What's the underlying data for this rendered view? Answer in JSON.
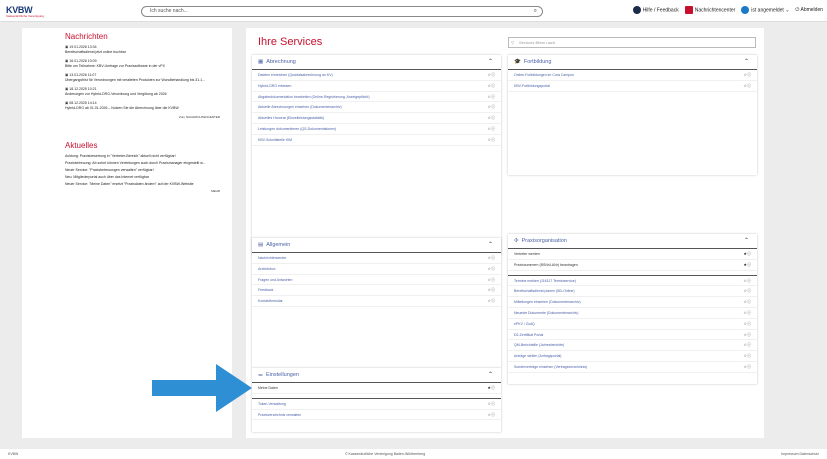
{
  "header": {
    "logo_main": "KVBW",
    "logo_sub": "Kassenärztliche Vereinigung",
    "search_placeholder": "Ich suche nach...",
    "help": "Hilfe / Feedback",
    "messages": "Nachrichtencenter",
    "user": "ist angemeldet",
    "logout": "Abmelden"
  },
  "left": {
    "news_title": "Nachrichten",
    "news": [
      {
        "date": "19.01.2026 13:34",
        "text": "Bereitschaftsdienst jetzt online buchbar"
      },
      {
        "date": "16.01.2026 10:09",
        "text": "Bitte um Teilnahme: KBV-Umfrage zur Praxissoftware in der vPX"
      },
      {
        "date": "13.01.2026 11:07",
        "text": "Übergangsfrist für Verordnungen mit veralteten Produkten zur Wundbehandlung bis 31.1..."
      },
      {
        "date": "18.12.2025 10:21",
        "text": "Änderungen zur Hybrid-DRG-Verordnung und Vergütung ab 2026"
      },
      {
        "date": "08.12.2025 14:14",
        "text": "Hybrid-DRG ab 01.01.2026 – Nutzen Sie die Abrechnung über die KVBW"
      }
    ],
    "news_more": "Zum NACHRICHTENCENTER",
    "aktuell_title": "Aktuelles",
    "aktuell": [
      "Achtung: Praxisbewertung in \"Vertreter-Bereich\" aktuell nicht verfügbar!",
      "Praxisbetreuung: Ab sofort können Vertretungen auch durch Praxismanager eingestellt w...",
      "Neuer Service: \"Praxisbetreuungen verwalten\" verfügbar!",
      "Neu: Mitgliederportal auch über das Internet verfügbar",
      "Neuer Service: \"Meine Daten\" ersetzt \"Praxisdaten ändern\" auf der KVBW-Website"
    ],
    "aktuell_more": "MEHR"
  },
  "main": {
    "title": "Ihre Services",
    "filter_placeholder": "Services filtern nach"
  },
  "cards": {
    "abrechnung": {
      "title": "Abrechnung",
      "items": [
        "Dateien einreichen (Quartalsabrechnung an KV)",
        "Hybrid-DRG erfassen",
        "Abgabedokumentation bearbeiten (Online-Registrierung, Anzeigepflicht)",
        "Aktuelle Abrechnungen einsehen (Dokumentenarchiv)",
        "Aktuelles Honorar (Einzelleistungsstatistik)",
        "Leistungen dokumentieren (QS-Dokumentationen)",
        "KBV-Schnittstelle KIM"
      ]
    },
    "fortbildung": {
      "title": "Fortbildung",
      "items": [
        "Online-Fortbildungen im Cura Campus",
        "KBV-Fortbildungsportal"
      ]
    },
    "allgemein": {
      "title": "Allgemein",
      "items": [
        "Nachrichtencenter",
        "Arztinfobox",
        "Fragen und Antworten",
        "Feedback",
        "Kontaktformular"
      ]
    },
    "praxis": {
      "title": "Praxisorganisation",
      "items_top": [
        "Vertreter werden",
        "Praxisnummern (BSNr/LANr) beantragen"
      ],
      "items_bottom": [
        "Termine melden (116117 Terminservice)",
        "Bereitschaftsdienst planen (BD-Online)",
        "Mitteilungen einsehen (Dokumentenarchiv)",
        "Neueste Dokumente (Dokumentenarchiv)",
        "ePKV / ZodQ",
        "D2-Zertifikat Portal",
        "QM-Berichtsfile (Jahresberichte)",
        "Anträge stellen (Antragsportal)",
        "Sonderverträge einsehen (Vertragsverzeichnis)"
      ]
    },
    "einstellungen": {
      "title": "Einstellungen",
      "items_top": [
        "Meine Daten"
      ],
      "items_bottom": [
        "Token-Verwaltung",
        "Praxisverzeichnis verwalten"
      ]
    }
  },
  "icons": {
    "star": "☆",
    "star_filled": "★",
    "info": "ⓘ",
    "chevron_up": "⌃"
  },
  "footer": {
    "left": "KVBW",
    "center": "© Kassenärztliche Vereinigung Baden-Württemberg",
    "right": "Impressum   Datenschutz"
  },
  "colors": {
    "brand_red": "#c8102e",
    "link_blue": "#4a62a8",
    "arrow_blue": "#2f8fd4"
  }
}
